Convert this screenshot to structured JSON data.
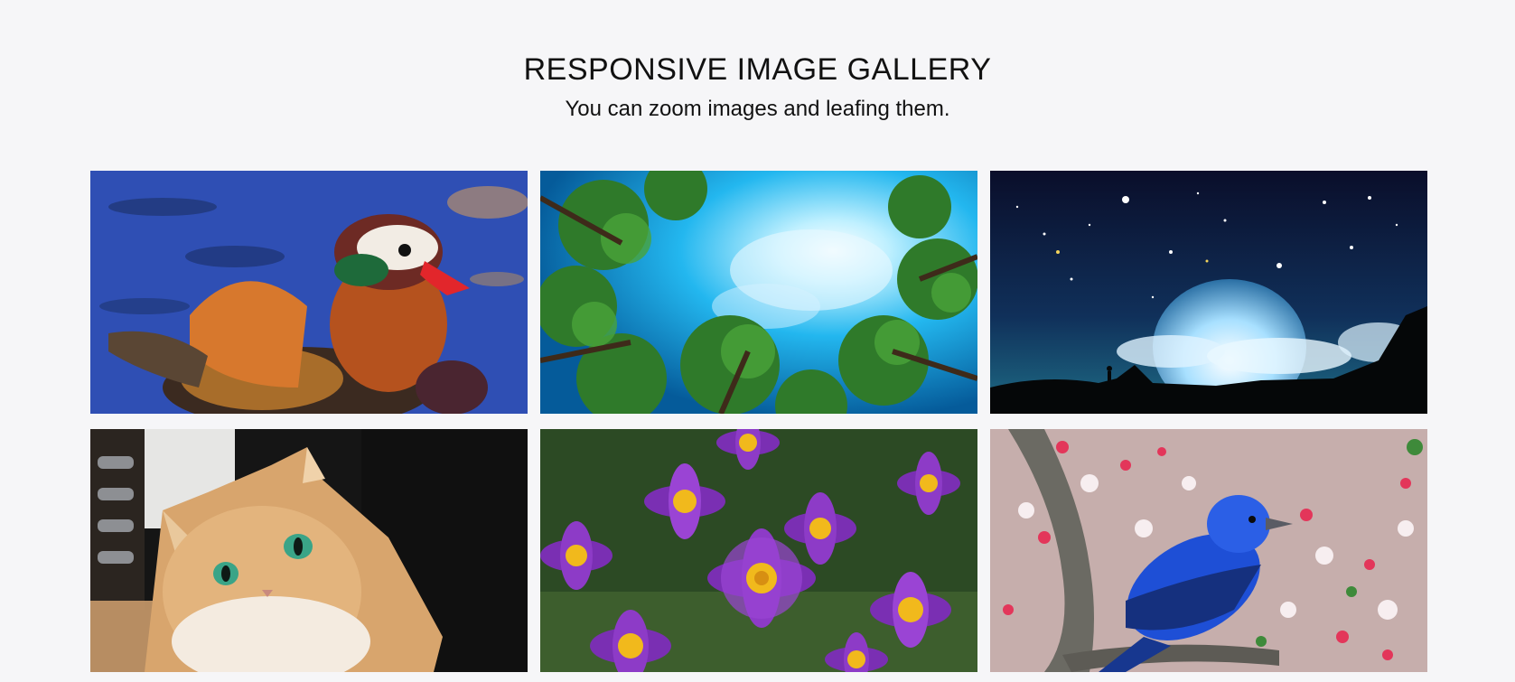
{
  "header": {
    "title": "RESPONSIVE IMAGE GALLERY",
    "subtitle": "You can zoom images and leafing them."
  },
  "gallery": {
    "images": [
      {
        "subject": "mandarin duck on blue water"
      },
      {
        "subject": "looking up through forest trees at bright sky"
      },
      {
        "subject": "starry night sky with large moon and silhouette"
      },
      {
        "subject": "fluffy ginger cat with green eyes"
      },
      {
        "subject": "purple pasque flowers with yellow centers"
      },
      {
        "subject": "blue bird on branch with pink blossoms"
      }
    ]
  }
}
